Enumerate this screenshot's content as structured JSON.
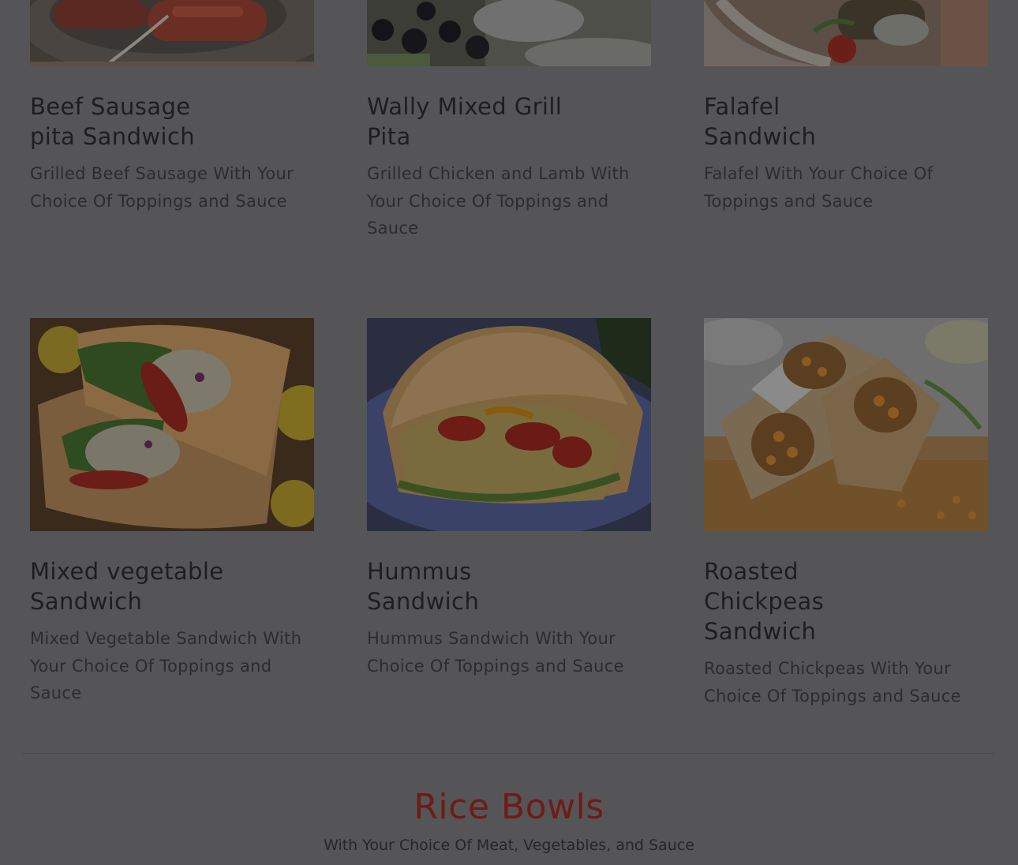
{
  "menu_items": [
    {
      "title_line1": "Beef Sausage",
      "title_line2": "pita Sandwich",
      "title_line3": "",
      "description": "Grilled Beef Sausage With Your Choice Of Toppings and Sauce"
    },
    {
      "title_line1": "Wally Mixed Grill",
      "title_line2": "Pita",
      "title_line3": "",
      "description": "Grilled Chicken and Lamb With Your Choice Of Toppings and Sauce"
    },
    {
      "title_line1": "Falafel",
      "title_line2": "Sandwich",
      "title_line3": "",
      "description": "Falafel With Your Choice Of Toppings and Sauce"
    },
    {
      "title_line1": "Mixed vegetable",
      "title_line2": "Sandwich",
      "title_line3": "",
      "description": "Mixed Vegetable Sandwich With Your Choice Of Toppings and Sauce"
    },
    {
      "title_line1": "Hummus",
      "title_line2": "Sandwich",
      "title_line3": "",
      "description": "Hummus  Sandwich With Your Choice Of Toppings and Sauce"
    },
    {
      "title_line1": "Roasted",
      "title_line2": "Chickpeas",
      "title_line3": "Sandwich",
      "description": "Roasted Chickpeas With Your Choice Of Toppings and Sauce"
    }
  ],
  "section": {
    "title": "Rice Bowls",
    "subtitle": "With Your Choice Of Meat, Vegetables, and Sauce"
  },
  "colors": {
    "overlay_background": "#555558",
    "section_title": "#6e1c14"
  }
}
